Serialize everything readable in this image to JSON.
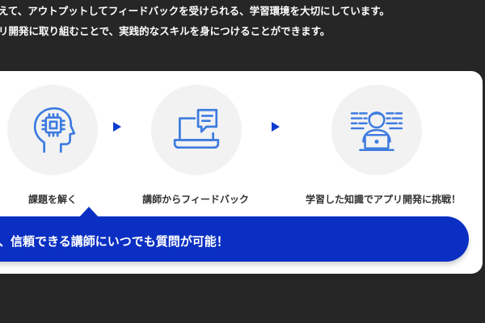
{
  "intro": {
    "line1": "えて、アウトプットしてフィードバックを受けられる、学習環境を大切にしています。",
    "line2": "リ開発に取り組むことで、実践的なスキルを身につけることができます。"
  },
  "steps": [
    {
      "label": "課題を解く",
      "icon": "ai-head-icon"
    },
    {
      "label": "講師からフィードバック",
      "icon": "laptop-chat-icon"
    },
    {
      "label": "学習した知識でアプリ開発に挑戦！",
      "icon": "developer-icon"
    }
  ],
  "banner": {
    "text": "、信頼できる講師にいつでも質問が可能！"
  },
  "colors": {
    "accent": "#0a2fc2",
    "icon_blue": "#3d7be0",
    "arrow": "#0a3bcf",
    "background": "#262626"
  }
}
